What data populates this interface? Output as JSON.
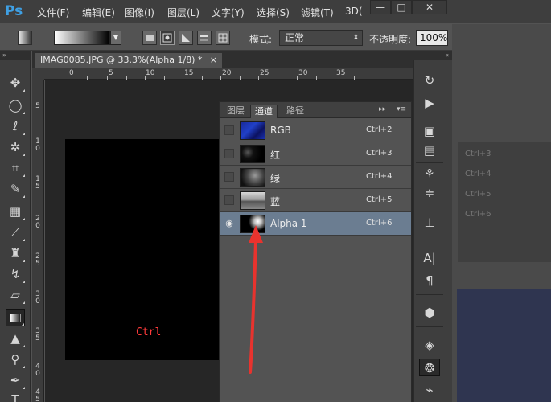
{
  "app": {
    "logo": "Ps"
  },
  "menu": {
    "items": [
      "文件(F)",
      "编辑(E)",
      "图像(I)",
      "图层(L)",
      "文字(Y)",
      "选择(S)",
      "滤镜(T)",
      "3D("
    ]
  },
  "window_controls": {
    "minimize": "—",
    "restore": "□",
    "close": "✕"
  },
  "options": {
    "mode_label": "模式:",
    "mode_value": "正常",
    "opacity_label": "不透明度:",
    "opacity_value": "100%"
  },
  "document": {
    "tab_title": "IMAG0085.JPG @ 33.3%(Alpha 1/8) *",
    "tab_close": "×",
    "ruler_h": [
      "0",
      "5",
      "10",
      "15",
      "20",
      "25",
      "30",
      "35"
    ],
    "ruler_v": [
      "5",
      "1\n0",
      "1\n5",
      "2\n0",
      "2\n5",
      "3\n0",
      "3\n5",
      "4\n0",
      "4\n5"
    ],
    "annotation": "Ctrl"
  },
  "panel": {
    "tabs": [
      "图层",
      "通道",
      "路径"
    ],
    "active_tab": "通道",
    "channels": [
      {
        "name": "RGB",
        "shortcut": "Ctrl+2",
        "visible": false,
        "selected": false
      },
      {
        "name": "红",
        "shortcut": "Ctrl+3",
        "visible": false,
        "selected": false
      },
      {
        "name": "绿",
        "shortcut": "Ctrl+4",
        "visible": false,
        "selected": false
      },
      {
        "name": "蓝",
        "shortcut": "Ctrl+5",
        "visible": false,
        "selected": false
      },
      {
        "name": "Alpha 1",
        "shortcut": "Ctrl+6",
        "visible": true,
        "selected": true
      }
    ],
    "collapse_glyph": "▸▸",
    "menu_glyph": "▾≡"
  },
  "background_panel": {
    "shortcuts": [
      "Ctrl+3",
      "Ctrl+4",
      "Ctrl+5",
      "Ctrl+6"
    ]
  },
  "colors": {
    "accent_selection": "#6b7d91",
    "arrow": "#e8332e",
    "ctrl_text": "#ff3b3b"
  }
}
